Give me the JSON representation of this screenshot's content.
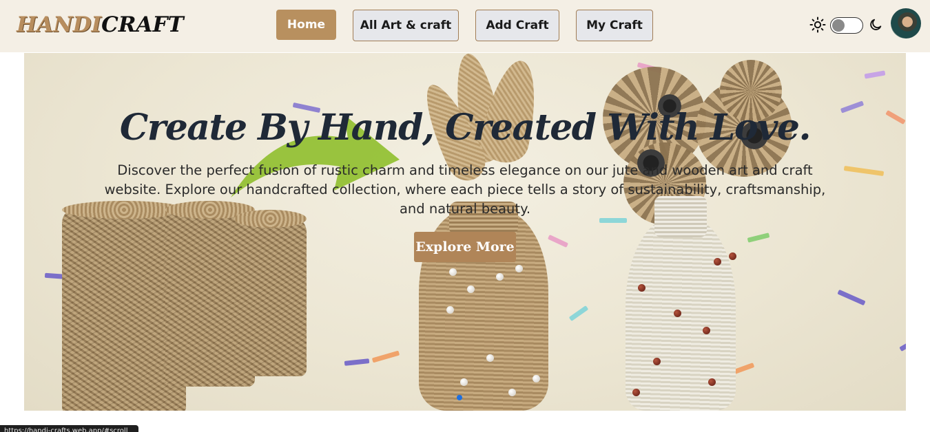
{
  "logo": {
    "part1": "HANDI",
    "part2": "CRAFT"
  },
  "nav": {
    "items": [
      {
        "label": "Home",
        "active": true
      },
      {
        "label": "All Art & craft",
        "active": false
      },
      {
        "label": "Add Craft",
        "active": false
      },
      {
        "label": "My Craft",
        "active": false
      }
    ]
  },
  "theme": {
    "light_icon": "sun-icon",
    "dark_icon": "moon-icon",
    "dark_mode": false
  },
  "hero": {
    "title": "Create By Hand, Created With Love.",
    "description": "Discover the perfect fusion of rustic charm and timeless elegance on our jute and wooden art and craft website. Explore our handcrafted collection, where each piece tells a story of sustainability, craftsmanship, and natural beauty.",
    "button_label": "Explore More"
  },
  "status_bar": {
    "url": "https://handi-crafts.web.app/#scroll"
  },
  "colors": {
    "accent": "#b8905f",
    "nav_bg": "#f4efe5",
    "active_dot": "#1d6fe0"
  }
}
